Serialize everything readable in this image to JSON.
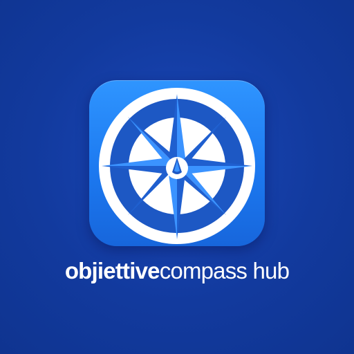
{
  "logo": {
    "icon": "compass-rose-icon",
    "wordmark_bold": "objiettive",
    "wordmark_regular": "compass hub"
  },
  "colors": {
    "background": "#123a9e",
    "tile_top": "#2f95ff",
    "tile_bottom": "#1766dc",
    "ring_white": "#ffffff",
    "ring_dark": "#1d58c4",
    "star_light": "#3b93ff",
    "star_dark": "#1f5fcf",
    "wordmark": "#ffffff"
  }
}
